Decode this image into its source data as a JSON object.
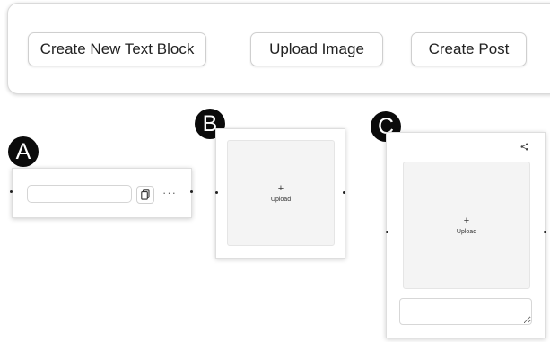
{
  "toolbar": {
    "create_text_block_label": "Create New Text Block",
    "upload_image_label": "Upload Image",
    "create_post_label": "Create Post"
  },
  "panels": {
    "a": {
      "marker": "A",
      "input_value": "",
      "copy_icon": "copy-icon",
      "more_label": "···"
    },
    "b": {
      "marker": "B",
      "plus": "+",
      "upload_label": "Upload"
    },
    "c": {
      "marker": "C",
      "share_icon": "share-icon",
      "plus": "+",
      "upload_label": "Upload",
      "textarea_value": ""
    }
  }
}
